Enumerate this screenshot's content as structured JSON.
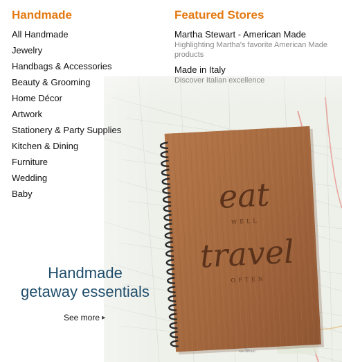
{
  "handmade": {
    "heading": "Handmade",
    "categories": [
      "All Handmade",
      "Jewelry",
      "Handbags & Accessories",
      "Beauty & Grooming",
      "Home Décor",
      "Artwork",
      "Stationery & Party Supplies",
      "Kitchen & Dining",
      "Furniture",
      "Wedding",
      "Baby"
    ]
  },
  "featured": {
    "heading": "Featured Stores",
    "stores": [
      {
        "name": "Martha Stewart - American Made",
        "description": "Highlighting Martha's favorite American Made products"
      },
      {
        "name": "Made in Italy",
        "description": "Discover Italian excellence"
      }
    ]
  },
  "promo": {
    "title_line1": "Handmade",
    "title_line2": "getaway essentials",
    "see_more": "See more",
    "image": {
      "engraving_top": "eat",
      "engraving_small1": "WELL",
      "engraving_middle": "travel",
      "engraving_small2": "OFTEN",
      "map_label": "SAN BRUNO"
    }
  },
  "colors": {
    "heading_orange": "#e47911",
    "promo_title_blue": "#1f4d6b",
    "desc_gray": "#888888",
    "wood": "#a5693f"
  }
}
